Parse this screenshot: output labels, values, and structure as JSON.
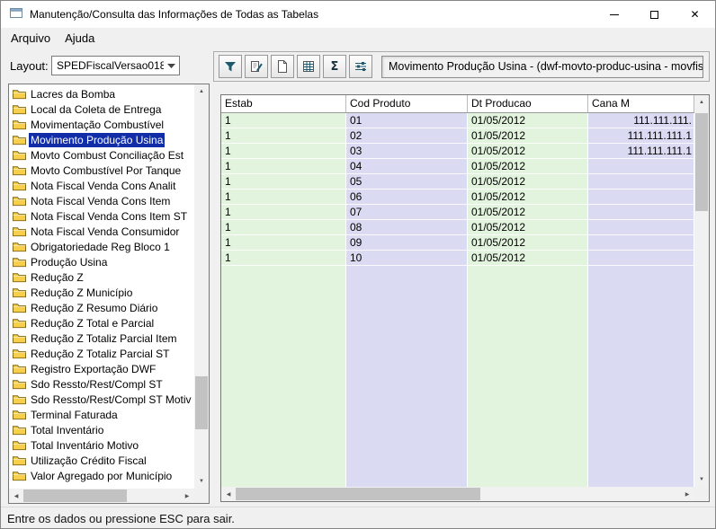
{
  "window": {
    "title": "Manutenção/Consulta das Informações de Todas as Tabelas"
  },
  "menu": {
    "items": [
      {
        "label": "Arquivo"
      },
      {
        "label": "Ajuda"
      }
    ]
  },
  "layout_bar": {
    "label": "Layout:",
    "selected": "SPEDFiscalVersao018"
  },
  "tree": {
    "items": [
      {
        "label": "Lacres da Bomba"
      },
      {
        "label": "Local da Coleta de Entrega"
      },
      {
        "label": "Movimentação Combustível"
      },
      {
        "label": "Movimento Produção Usina",
        "selected": true
      },
      {
        "label": "Movto Combust Conciliação Est"
      },
      {
        "label": "Movto Combustível Por Tanque"
      },
      {
        "label": "Nota Fiscal Venda Cons Analit"
      },
      {
        "label": "Nota Fiscal Venda Cons Item"
      },
      {
        "label": "Nota Fiscal Venda Cons Item ST"
      },
      {
        "label": "Nota Fiscal Venda Consumidor"
      },
      {
        "label": "Obrigatoriedade Reg Bloco 1"
      },
      {
        "label": "Produção Usina"
      },
      {
        "label": "Redução Z"
      },
      {
        "label": "Redução Z Município"
      },
      {
        "label": "Redução Z Resumo Diário"
      },
      {
        "label": "Redução Z Total e Parcial"
      },
      {
        "label": "Redução Z Totaliz Parcial Item"
      },
      {
        "label": "Redução Z Totaliz Parcial ST"
      },
      {
        "label": "Registro Exportação DWF"
      },
      {
        "label": "Sdo Ressto/Rest/Compl ST"
      },
      {
        "label": "Sdo Ressto/Rest/Compl ST Motiv"
      },
      {
        "label": "Terminal Faturada"
      },
      {
        "label": "Total Inventário"
      },
      {
        "label": "Total Inventário Motivo"
      },
      {
        "label": "Utilização Crédito Fiscal"
      },
      {
        "label": "Valor Agregado por Município"
      }
    ]
  },
  "toolbar": {
    "buttons": [
      {
        "name": "filter",
        "icon": "filter-icon"
      },
      {
        "name": "edit",
        "icon": "edit-icon"
      },
      {
        "name": "new-document",
        "icon": "document-icon"
      },
      {
        "name": "spreadsheet",
        "icon": "spreadsheet-icon"
      },
      {
        "name": "sum",
        "icon": "sigma-icon"
      },
      {
        "name": "adjust",
        "icon": "sliders-icon"
      }
    ],
    "context_label": "Movimento Produção Usina - (dwf-movto-produc-usina - movfis)"
  },
  "grid": {
    "columns": [
      "Estab",
      "Cod Produto",
      "Dt Producao",
      "Cana M"
    ],
    "rows": [
      [
        "1",
        "01",
        "01/05/2012",
        "111.111.111."
      ],
      [
        "1",
        "02",
        "01/05/2012",
        "111.111.111.1"
      ],
      [
        "1",
        "03",
        "01/05/2012",
        "111.111.111.1"
      ],
      [
        "1",
        "04",
        "01/05/2012",
        ""
      ],
      [
        "1",
        "05",
        "01/05/2012",
        ""
      ],
      [
        "1",
        "06",
        "01/05/2012",
        ""
      ],
      [
        "1",
        "07",
        "01/05/2012",
        ""
      ],
      [
        "1",
        "08",
        "01/05/2012",
        ""
      ],
      [
        "1",
        "09",
        "01/05/2012",
        ""
      ],
      [
        "1",
        "10",
        "01/05/2012",
        ""
      ]
    ]
  },
  "status_bar": {
    "text": "Entre os dados ou pressione ESC para sair."
  },
  "colors": {
    "selection": "#112ea8",
    "grid_green": "#e2f3de",
    "grid_lavender": "#dadaf3",
    "icon": "#1d5a6e",
    "folder_yellow": "#f7cf4b"
  }
}
